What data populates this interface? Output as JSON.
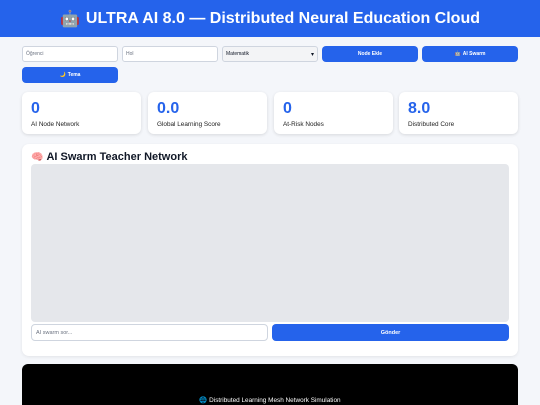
{
  "header": {
    "icon": "robot-icon",
    "icon_glyph": "🤖",
    "title": "ULTRA AI 8.0 — Distributed Neural Education Cloud"
  },
  "controls": {
    "student_placeholder": "Öğrenci",
    "goal_placeholder": "Hol",
    "subject_selected": "Matematik",
    "add_node_label": "Node Ekle",
    "ai_swarm_icon": "🤖",
    "ai_swarm_label": "AI Swarm",
    "theme_icon": "🌙",
    "theme_label": "Tema"
  },
  "stats": [
    {
      "value": "0",
      "label": "AI Node Network"
    },
    {
      "value": "0.0",
      "label": "Global Learning Score"
    },
    {
      "value": "0",
      "label": "At-Risk Nodes"
    },
    {
      "value": "8.0",
      "label": "Distributed Core"
    }
  ],
  "teacher_panel": {
    "icon": "🧠",
    "title": "AI Swarm Teacher Network",
    "input_placeholder": "AI swarm sor...",
    "send_label": "Gönder"
  },
  "simulation": {
    "icon": "🌐",
    "label": "Distributed Learning Mesh Network Simulation"
  },
  "colors": {
    "accent": "#2563eb",
    "background": "#f4f6fa",
    "simulation_bg": "#000000"
  }
}
